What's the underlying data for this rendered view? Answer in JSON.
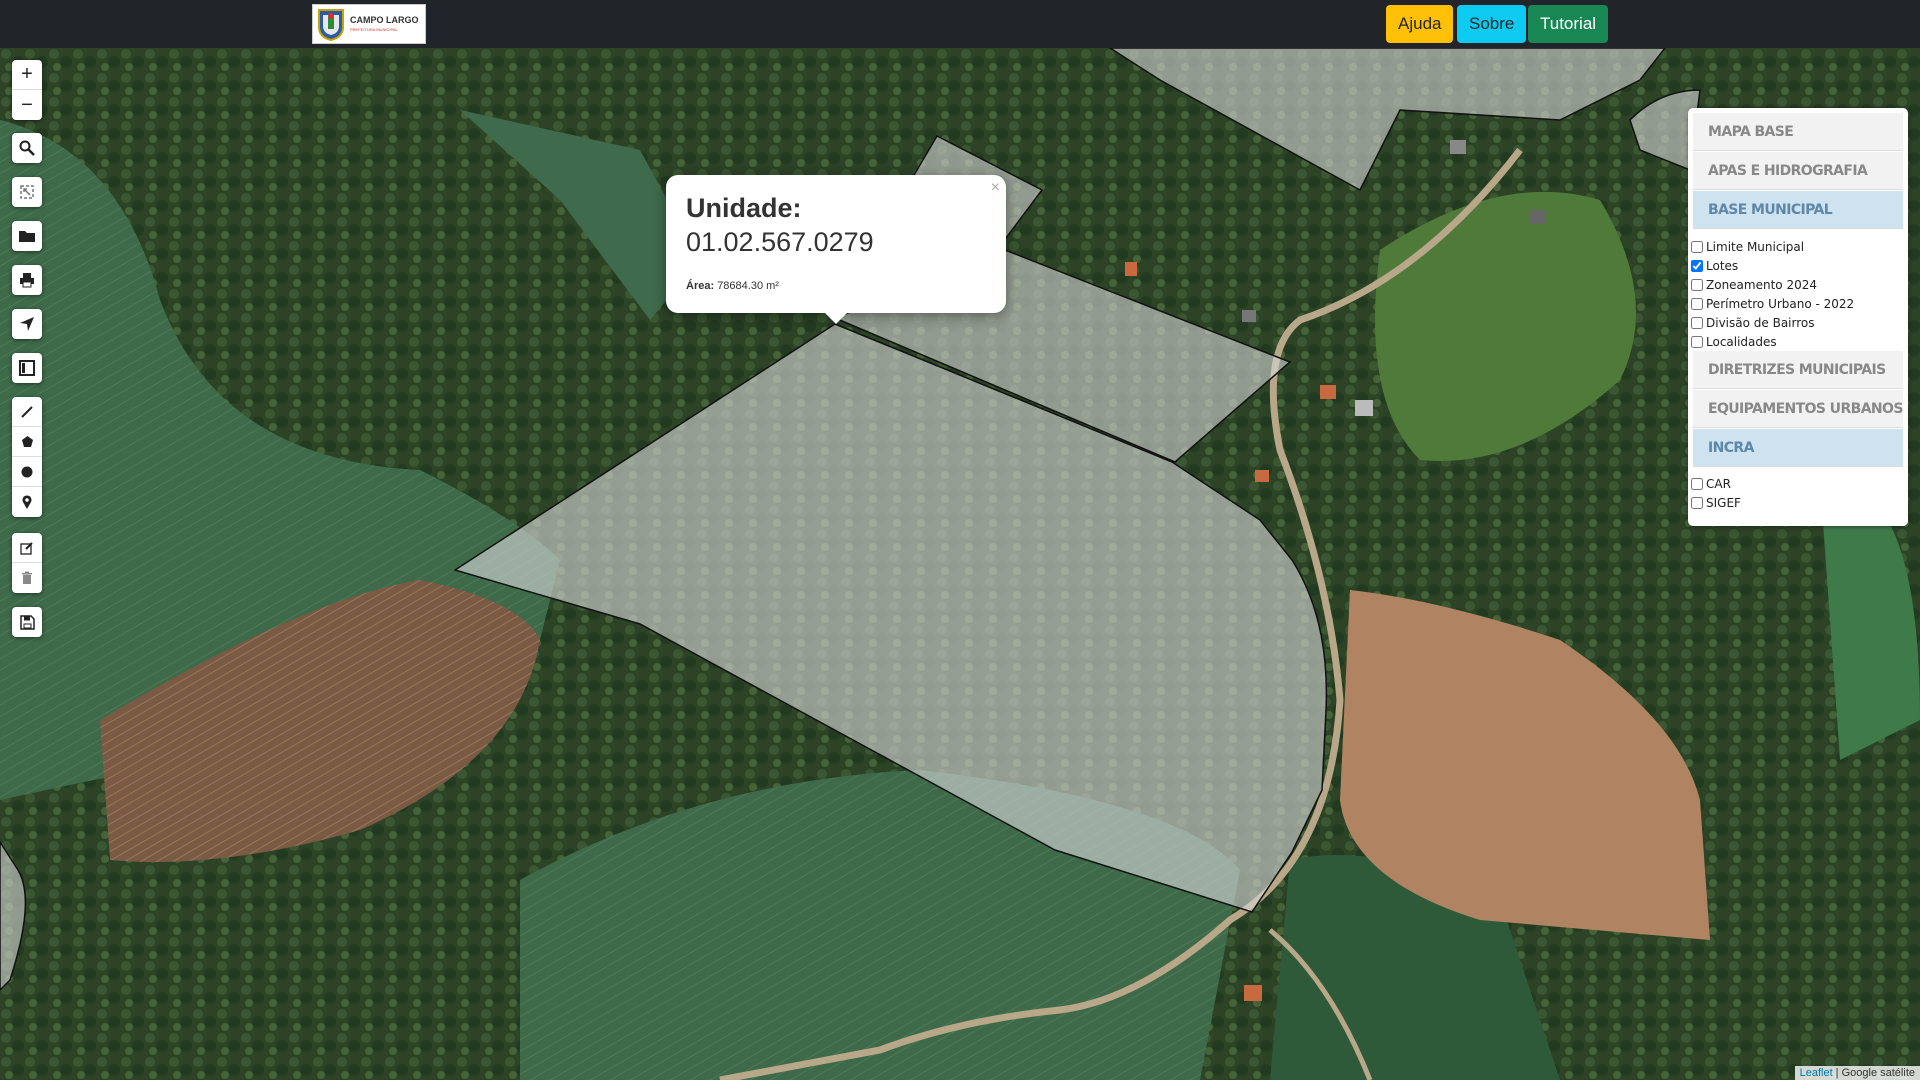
{
  "header": {
    "logo_title": "CAMPO LARGO",
    "logo_subtitle": "PREFEITURA MUNICIPAL",
    "buttons": {
      "ajuda": "Ajuda",
      "sobre": "Sobre",
      "tutorial": "Tutorial"
    },
    "colors": {
      "ajuda": "#ffc107",
      "sobre": "#0dcaf0",
      "tutorial": "#198754"
    }
  },
  "map_tools": {
    "zoom_in": "+",
    "zoom_out": "−",
    "icons": [
      "search-icon",
      "fullscreen-icon",
      "folder-icon",
      "print-icon",
      "locate-icon",
      "frame-icon",
      "polyline-icon",
      "polygon-icon",
      "circle-icon",
      "marker-icon",
      "edit-icon",
      "trash-icon",
      "save-icon"
    ]
  },
  "popup": {
    "close": "×",
    "title": "Unidade:",
    "code": "01.02.567.0279",
    "area_label": "Área:",
    "area_value": "78684.30 m²"
  },
  "layers": {
    "sections": {
      "mapa_base": "MAPA BASE",
      "apas": "APAS E HIDROGRAFIA",
      "base_municipal": "BASE MUNICIPAL",
      "diretrizes": "DIRETRIZES MUNICIPAIS",
      "equipamentos": "EQUIPAMENTOS URBANOS",
      "incra": "INCRA"
    },
    "base_municipal_items": [
      {
        "label": "Limite Municipal",
        "checked": false
      },
      {
        "label": "Lotes",
        "checked": true
      },
      {
        "label": "Zoneamento 2024",
        "checked": false
      },
      {
        "label": "Perímetro Urbano - 2022",
        "checked": false
      },
      {
        "label": "Divisão de Bairros",
        "checked": false
      },
      {
        "label": "Localidades",
        "checked": false
      }
    ],
    "incra_items": [
      {
        "label": "CAR",
        "checked": false
      },
      {
        "label": "SIGEF",
        "checked": false
      }
    ]
  },
  "attribution": {
    "leaflet": "Leaflet",
    "separator": " | ",
    "source": "Google satélite"
  }
}
